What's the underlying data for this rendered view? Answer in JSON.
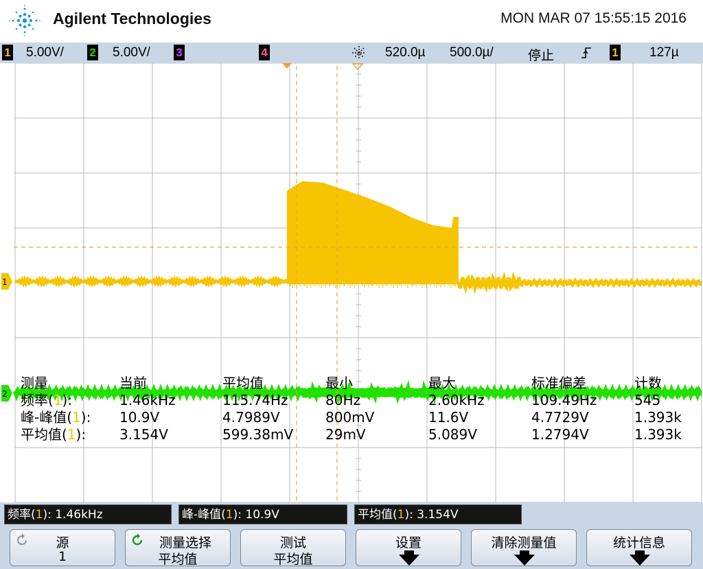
{
  "header": {
    "brand": "Agilent Technologies",
    "datetime": "MON MAR 07 15:55:15 2016"
  },
  "status_bar": {
    "ch1": {
      "num": "1",
      "scale": "5.00V/",
      "color": "#f6c400"
    },
    "ch2": {
      "num": "2",
      "scale": "5.00V/",
      "color": "#22e000"
    },
    "ch3": {
      "num": "3",
      "color": "#c050ff"
    },
    "ch4": {
      "num": "4",
      "color": "#ff5aa0"
    },
    "delay": "520.0µ",
    "timebase": "500.0µ/",
    "run_state": "停止",
    "trigger_source": "1",
    "trigger_level": "127µ"
  },
  "display": {
    "ch1_marker": "1",
    "ch2_marker": "2"
  },
  "measure_table": {
    "headers": [
      "测量",
      "当前",
      "平均值",
      "最小",
      "最大",
      "标准偏差",
      "计数"
    ],
    "rows": [
      {
        "name": "频率",
        "ch": "1",
        "suffix": "):",
        "values": [
          "1.46kHz",
          "115.74Hz",
          "80Hz",
          "2.60kHz",
          "109.49Hz",
          "545"
        ]
      },
      {
        "name": "峰-峰值",
        "ch": "1",
        "suffix": "):",
        "values": [
          "10.9V",
          "4.7989V",
          "800mV",
          "11.6V",
          "4.7729V",
          "1.393k"
        ]
      },
      {
        "name": "平均值",
        "ch": "1",
        "suffix": "):",
        "values": [
          "3.154V",
          "599.38mV",
          "29mV",
          "5.089V",
          "1.2794V",
          "1.393k"
        ]
      }
    ]
  },
  "readouts": [
    {
      "name": "频率",
      "ch": "1",
      "value": "): 1.46kHz"
    },
    {
      "name": "峰-峰值",
      "ch": "1",
      "value": "): 10.9V"
    },
    {
      "name": "平均值",
      "ch": "1",
      "value": "): 3.154V"
    }
  ],
  "softkeys": [
    {
      "line1": "源",
      "line2": "1"
    },
    {
      "line1": "测量选择",
      "line2": "平均值"
    },
    {
      "line1": "测试",
      "line2": "平均值"
    },
    {
      "line1": "设置"
    },
    {
      "line1": "清除测量值"
    },
    {
      "line1": "统计信息"
    }
  ],
  "colors": {
    "ch1": "#f6c400",
    "ch2": "#22e000",
    "grid": "#b8b8b8",
    "status_bg": "#c9d6e6"
  }
}
